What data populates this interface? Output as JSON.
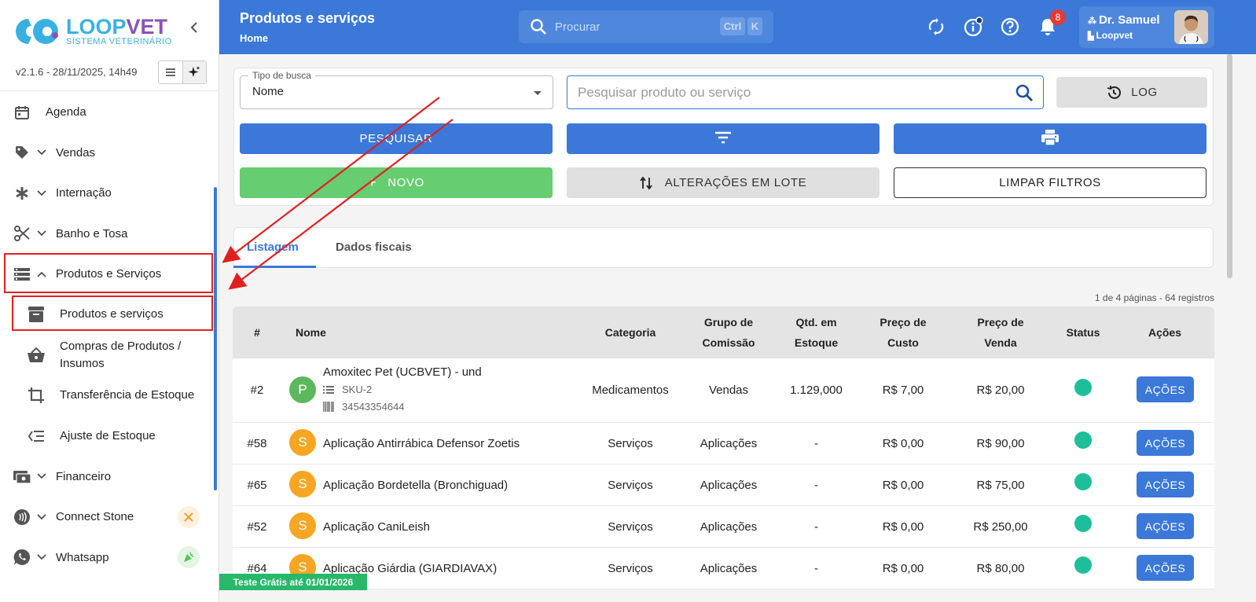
{
  "brand": {
    "name_a": "LOOP",
    "name_b": "VET",
    "subtitle": "SISTEMA VETERINÁRIO"
  },
  "version": "v2.1.6 - 28/11/2025, 14h49",
  "sidebar": {
    "items": [
      {
        "label": "Agenda",
        "icon": "calendar-icon"
      },
      {
        "label": "Vendas",
        "icon": "tag-icon"
      },
      {
        "label": "Internação",
        "icon": "asterisk-icon"
      },
      {
        "label": "Banho e Tosa",
        "icon": "scissors-icon"
      },
      {
        "label": "Produtos e Serviços",
        "icon": "storage-icon"
      },
      {
        "label": "Produtos e serviços",
        "icon": "archive-icon"
      },
      {
        "label": "Compras de Produtos / Insumos",
        "icon": "basket-icon"
      },
      {
        "label": "Transferência de Estoque",
        "icon": "crop-icon"
      },
      {
        "label": "Ajuste de Estoque",
        "icon": "list-adjust-icon"
      },
      {
        "label": "Financeiro",
        "icon": "cash-icon"
      },
      {
        "label": "Connect Stone",
        "icon": "contactless-icon"
      },
      {
        "label": "Whatsapp",
        "icon": "whatsapp-icon"
      }
    ]
  },
  "header": {
    "title": "Produtos e serviços",
    "breadcrumb": "Home",
    "search_placeholder": "Procurar",
    "kbd_ctrl": "Ctrl",
    "kbd_k": "K",
    "notifications": "8",
    "user_name": "Dr. Samuel",
    "user_org": "Loopvet"
  },
  "filters": {
    "type_label": "Tipo de busca",
    "type_value": "Nome",
    "search_placeholder": "Pesquisar produto ou serviço",
    "log": "LOG",
    "search_btn": "PESQUISAR",
    "new_btn": "NOVO",
    "batch_btn": "ALTERAÇÕES EM LOTE",
    "clear_btn": "LIMPAR FILTROS"
  },
  "tabs": [
    "Listagem",
    "Dados fiscais"
  ],
  "page_info": "1 de 4 páginas - 64 registros",
  "table": {
    "headers": {
      "num": "#",
      "nome": "Nome",
      "categoria": "Categoria",
      "grupo": "Grupo de Comissão",
      "qtd": "Qtd. em Estoque",
      "custo": "Preço de Custo",
      "venda": "Preço de Venda",
      "status": "Status",
      "acoes": "Ações"
    },
    "rows": [
      {
        "num": "#2",
        "letter": "P",
        "name": "Amoxitec Pet (UCBVET) - und",
        "sku": "SKU-2",
        "barcode": "34543354644",
        "categoria": "Medicamentos",
        "grupo": "Vendas",
        "qtd": "1.129,000",
        "custo": "R$ 7,00",
        "venda": "R$ 20,00",
        "acoes": "AÇÕES"
      },
      {
        "num": "#58",
        "letter": "S",
        "name": "Aplicação Antirrábica Defensor Zoetis",
        "categoria": "Serviços",
        "grupo": "Aplicações",
        "qtd": "-",
        "custo": "R$ 0,00",
        "venda": "R$ 90,00",
        "acoes": "AÇÕES"
      },
      {
        "num": "#65",
        "letter": "S",
        "name": "Aplicação Bordetella (Bronchiguad)",
        "categoria": "Serviços",
        "grupo": "Aplicações",
        "qtd": "-",
        "custo": "R$ 0,00",
        "venda": "R$ 75,00",
        "acoes": "AÇÕES"
      },
      {
        "num": "#52",
        "letter": "S",
        "name": "Aplicação CaniLeish",
        "categoria": "Serviços",
        "grupo": "Aplicações",
        "qtd": "-",
        "custo": "R$ 0,00",
        "venda": "R$ 250,00",
        "acoes": "AÇÕES"
      },
      {
        "num": "#64",
        "letter": "S",
        "name": "Aplicação Giárdia (GIARDIAVAX)",
        "categoria": "Serviços",
        "grupo": "Aplicações",
        "qtd": "-",
        "custo": "R$ 0,00",
        "venda": "R$ 80,00",
        "acoes": "AÇÕES"
      }
    ]
  },
  "trial_banner": "Teste Grátis até 01/01/2026",
  "colors": {
    "primary": "#3b78d8",
    "green": "#66cd70",
    "status_active": "#1dbf9a",
    "annotation": "#e02020"
  }
}
